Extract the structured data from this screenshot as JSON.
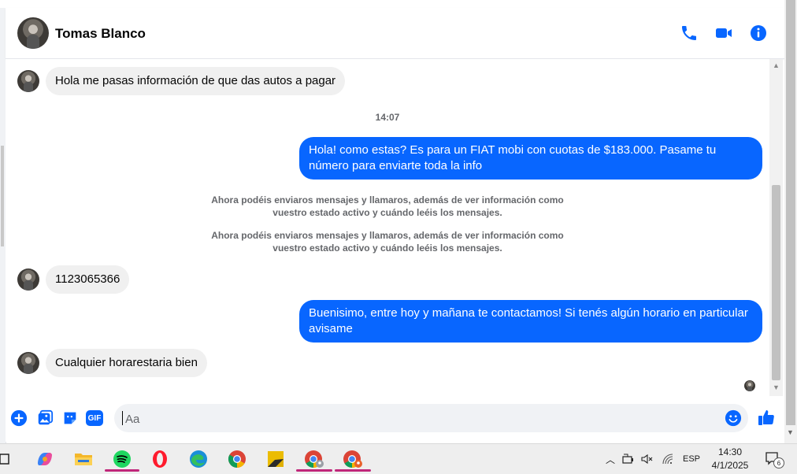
{
  "header": {
    "contact_name": "Tomas Blanco"
  },
  "messages": {
    "m1": "Hola me pasas información de que das autos a pagar",
    "time1": "14:07",
    "m2": "Hola! como estas? Es para un FIAT mobi con cuotas de $183.000. Pasame tu número para enviarte toda la info",
    "sys1": "Ahora podéis enviaros mensajes y llamaros, además de ver información como vuestro estado activo y cuándo leéis los mensajes.",
    "sys2": "Ahora podéis enviaros mensajes y llamaros, además de ver información como vuestro estado activo y cuándo leéis los mensajes.",
    "m3": "1123065366",
    "m4": "Buenisimo, entre hoy y mañana te contactamos! Si tenés algún horario en particular avisame",
    "m5": "Cualquier horarestaria bien"
  },
  "composer": {
    "placeholder": "Aa",
    "gif_label": "GIF"
  },
  "taskbar": {
    "language": "ESP",
    "time": "14:30",
    "date": "4/1/2025",
    "notification_count": "6"
  },
  "colors": {
    "accent": "#0866ff",
    "incoming_bubble": "#f0f0f0",
    "taskbar_active": "#c0267a"
  }
}
